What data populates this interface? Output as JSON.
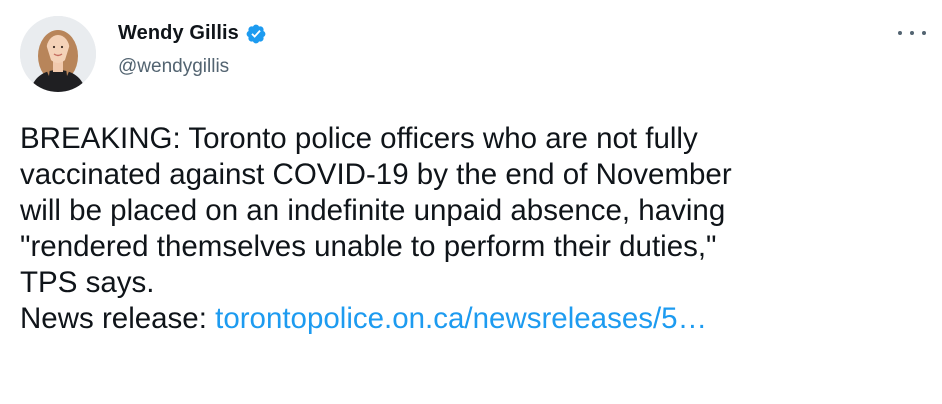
{
  "author": {
    "display_name": "Wendy Gillis",
    "handle": "@wendygillis",
    "verified": true,
    "verified_color": "#1d9bf0"
  },
  "tweet": {
    "body_line_1": "BREAKING: Toronto police officers who are not fully",
    "body_line_2": "vaccinated against COVID-19 by the end of November",
    "body_line_3": "will be placed on an indefinite unpaid absence, having",
    "body_line_4": "\"rendered themselves unable to perform their duties,\"",
    "body_line_5": "TPS says.",
    "news_release_label": "News release:",
    "link_text": "torontopolice.on.ca/newsreleases/5…",
    "link_color": "#1d9bf0"
  },
  "icons": {
    "verified": "verified-badge-icon",
    "more": "more-options-icon"
  }
}
